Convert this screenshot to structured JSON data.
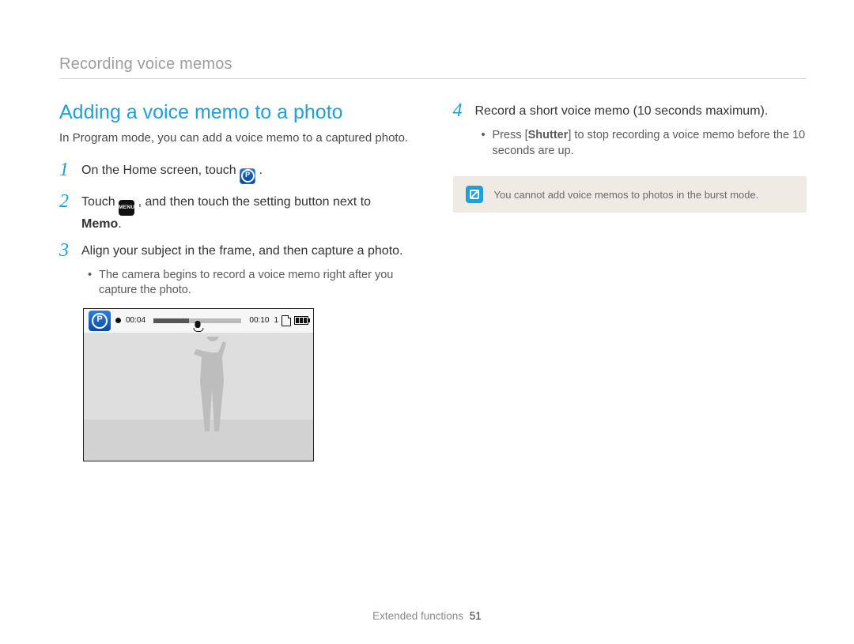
{
  "breadcrumb": "Recording voice memos",
  "heading": "Adding a voice memo to a photo",
  "intro": "In Program mode, you can add a voice memo to a captured photo.",
  "steps_left": [
    {
      "num": "1",
      "pre": "On the Home screen, touch ",
      "icon": "p-mode-icon",
      "post": "."
    },
    {
      "num": "2",
      "pre": "Touch ",
      "icon": "menu-icon",
      "icon_label": "MENU",
      "post_pre": ", and then touch the setting button next to ",
      "bold": "Memo",
      "post": "."
    },
    {
      "num": "3",
      "text": "Align your subject in the frame, and then capture a photo.",
      "sub": "The camera begins to record a voice memo right after you capture the photo."
    }
  ],
  "steps_right": [
    {
      "num": "4",
      "text": "Record a short voice memo (10 seconds maximum).",
      "sub_pre": "Press [",
      "sub_bold": "Shutter",
      "sub_post": "] to stop recording a voice memo before the 10 seconds are up."
    }
  ],
  "note": "You cannot add voice memos to photos in the burst mode.",
  "camera": {
    "elapsed": "00:04",
    "total": "00:10",
    "count": "1"
  },
  "footer_section": "Extended functions",
  "footer_page": "51"
}
